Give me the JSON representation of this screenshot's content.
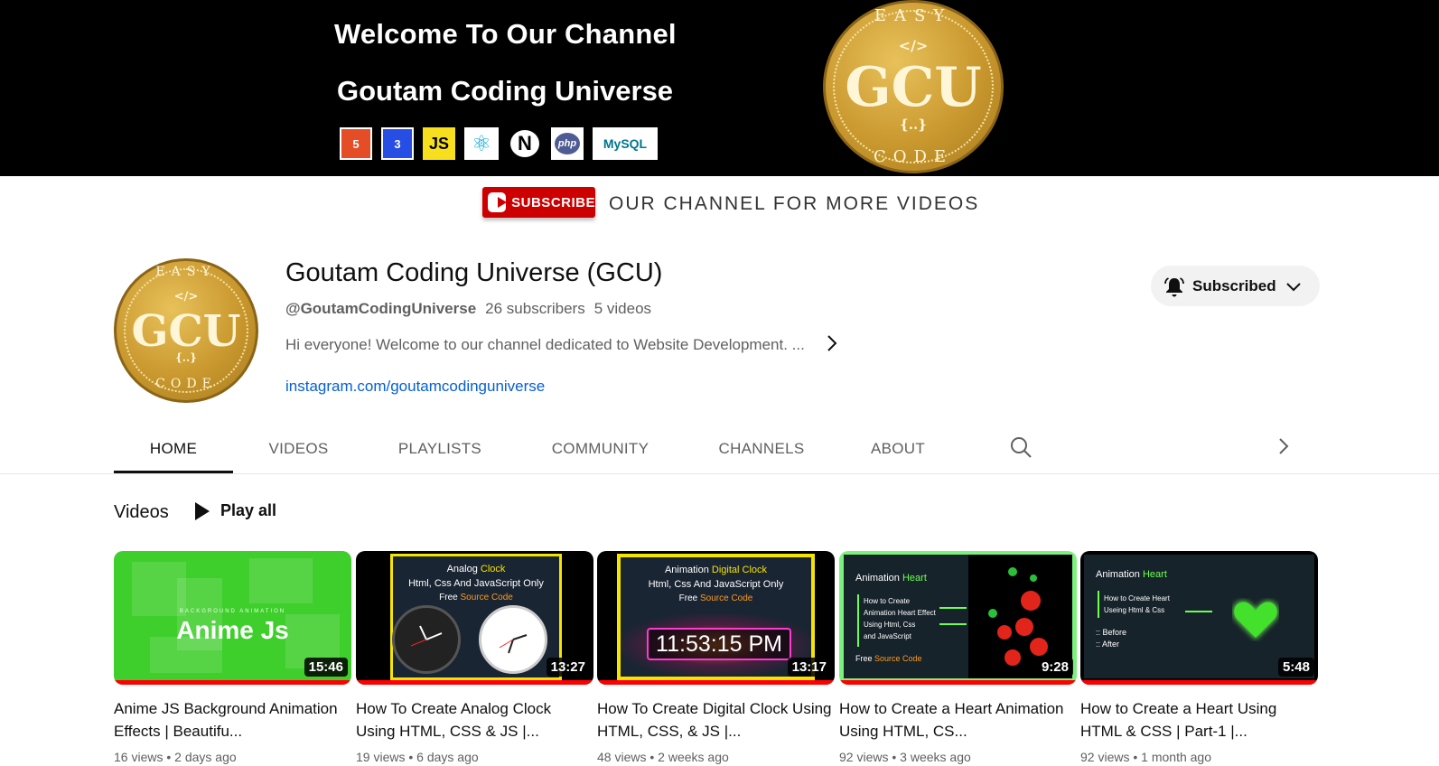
{
  "banner": {
    "line1": "Welcome To Our Channel",
    "line2": "Goutam Coding Universe",
    "tech_logos": [
      "5",
      "3",
      "JS",
      "⚛",
      "N",
      "php",
      "MySQL"
    ],
    "coin": {
      "top": "EASY",
      "tag": "</>",
      "center": "GCU",
      "brace": "{..}",
      "bottom": "CODE"
    }
  },
  "subscribe_strip": {
    "badge": "SUBSCRIBE",
    "text": "OUR CHANNEL FOR MORE VIDEOS"
  },
  "channel": {
    "name": "Goutam Coding Universe (GCU)",
    "handle": "@GoutamCodingUniverse",
    "subscribers": "26 subscribers",
    "videos_count": "5 videos",
    "description": "Hi everyone! Welcome to our channel dedicated to Website Development. ...",
    "link": "instagram.com/goutamcodinguniverse",
    "avatar": {
      "top": "EASY",
      "tag": "</>",
      "center": "GCU",
      "brace": "{..}",
      "bottom": "CODE"
    },
    "subscribe_button": "Subscribed"
  },
  "tabs": [
    {
      "label": "HOME",
      "active": true
    },
    {
      "label": "VIDEOS",
      "active": false
    },
    {
      "label": "PLAYLISTS",
      "active": false
    },
    {
      "label": "COMMUNITY",
      "active": false
    },
    {
      "label": "CHANNELS",
      "active": false
    },
    {
      "label": "ABOUT",
      "active": false
    }
  ],
  "shelf": {
    "title": "Videos",
    "play_all": "Play all",
    "videos": [
      {
        "title": "Anime JS Background Animation Effects | Beautifu...",
        "views": "16 views",
        "age": "2 days ago",
        "duration": "15:46",
        "thumb": {
          "kicker": "BACKGROUND ANIMATION",
          "big": "Anime Js"
        }
      },
      {
        "title": "How To Create Analog Clock Using HTML, CSS & JS |...",
        "views": "19 views",
        "age": "6 days ago",
        "duration": "13:27",
        "thumb": {
          "l1a": "Analog",
          "l1b": "Clock",
          "l2": "Html, Css And JavaScript Only",
          "l3a": "Free",
          "l3b": "Source Code"
        }
      },
      {
        "title": "How To Create Digital Clock Using HTML, CSS, & JS |...",
        "views": "48 views",
        "age": "2 weeks ago",
        "duration": "13:17",
        "thumb": {
          "l1a": "Animation",
          "l1b": "Digital Clock",
          "l2": "Html, Css And JavaScript Only",
          "l3a": "Free",
          "l3b": "Source Code",
          "time": "11:53:15 PM"
        }
      },
      {
        "title": "How to Create a Heart Animation Using HTML, CS...",
        "views": "92 views",
        "age": "3 weeks ago",
        "duration": "9:28",
        "thumb": {
          "h1a": "Animation",
          "h1b": "Heart",
          "b1": "How to Create",
          "b2": "Animation Heart Effect",
          "b3": "Using Html, Css",
          "b4": "and JavaScript",
          "f1": "Free",
          "f2": "Source Code"
        }
      },
      {
        "title": "How to Create a Heart Using HTML & CSS | Part-1 |...",
        "views": "92 views",
        "age": "1 month ago",
        "duration": "5:48",
        "thumb": {
          "h1a": "Animation",
          "h1b": "Heart",
          "b1": "How to Create Heart",
          "b2": "Useing Html & Css",
          "p1": ":: Before",
          "p2": ":: After"
        }
      }
    ]
  },
  "colors": {
    "progress": "#ff0000",
    "link": "#065fd4",
    "badge": "#cc0000"
  },
  "icons": [
    "bell-icon",
    "chevron-down-icon",
    "chevron-right-icon",
    "search-icon",
    "play-icon"
  ]
}
